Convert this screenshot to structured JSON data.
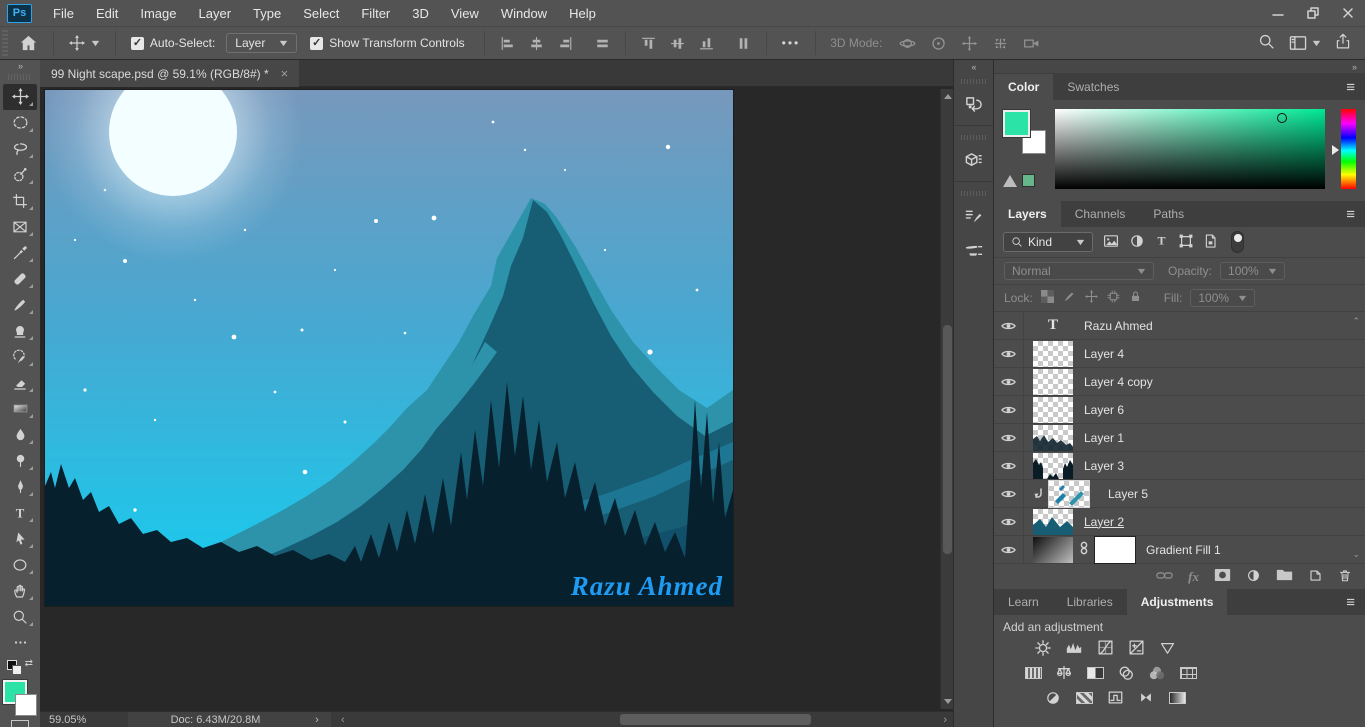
{
  "app": {
    "logo_text": "Ps"
  },
  "menubar": {
    "items": [
      "File",
      "Edit",
      "Image",
      "Layer",
      "Type",
      "Select",
      "Filter",
      "3D",
      "View",
      "Window",
      "Help"
    ]
  },
  "options_bar": {
    "auto_select_label": "Auto-Select:",
    "auto_select_value": "Layer",
    "show_transform_label": "Show Transform Controls",
    "mode_3d_label": "3D Mode:",
    "more_glyph": "•••"
  },
  "document": {
    "tab_title": "99 Night scape.psd @ 59.1% (RGB/8#) *",
    "close_glyph": "×",
    "zoom_level": "59.05%",
    "doc_info": "Doc: 6.43M/20.8M",
    "signature": "Razu Ahmed"
  },
  "color_panel": {
    "tabs": [
      "Color",
      "Swatches"
    ],
    "active_tab": "Color",
    "foreground_color": "#2BE3A6",
    "background_color": "#FFFFFF",
    "gamut_swatch_color": "#66B68C"
  },
  "layers_panel": {
    "tabs": [
      "Layers",
      "Channels",
      "Paths"
    ],
    "active_tab": "Layers",
    "filter_value": "Kind",
    "blend_mode": "Normal",
    "opacity_label": "Opacity:",
    "opacity_value": "100%",
    "lock_label": "Lock:",
    "fill_label": "Fill:",
    "fill_value": "100%",
    "layers": [
      {
        "name": "Razu Ahmed"
      },
      {
        "name": "Layer 4"
      },
      {
        "name": "Layer 4 copy"
      },
      {
        "name": "Layer 6"
      },
      {
        "name": "Layer 1"
      },
      {
        "name": "Layer 3"
      },
      {
        "name": "Layer 5"
      },
      {
        "name": "Layer 2"
      },
      {
        "name": "Gradient Fill 1"
      }
    ],
    "fx_label": "fx"
  },
  "adjustments_panel": {
    "tabs": [
      "Learn",
      "Libraries",
      "Adjustments"
    ],
    "active_tab": "Adjustments",
    "heading": "Add an adjustment"
  },
  "canvas": {
    "sky_top": "#7798BC",
    "sky_bottom": "#14CEF0",
    "moon_color": "#F2FEFF",
    "mountain_light": "#2D93AB",
    "mountain_mid": "#1D7693",
    "mountain_dark": "#175D73",
    "trees_color": "#06202E",
    "signature_color": "#1E9CF4"
  }
}
